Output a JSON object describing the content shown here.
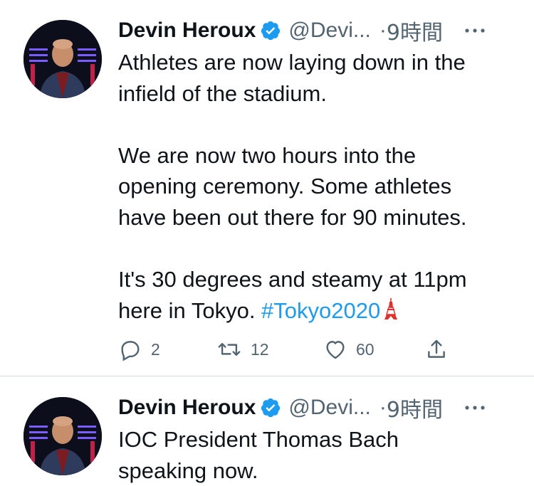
{
  "tweets": [
    {
      "author": {
        "name": "Devin Heroux",
        "handle": "@Devi...",
        "time": "9時間"
      },
      "lines": [
        "Athletes are now laying down in the",
        "infield of the stadium.",
        "",
        "We are now two hours into the",
        "opening ceremony. Some athletes",
        "have been out there for 90 minutes.",
        "",
        "It's 30 degrees and steamy at 11pm"
      ],
      "last_line_text": "here in Tokyo. ",
      "hashtag": "#Tokyo2020",
      "emoji_icon": "tokyo-tower-icon",
      "actions": {
        "replies": "2",
        "retweets": "12",
        "likes": "60"
      }
    },
    {
      "author": {
        "name": "Devin Heroux",
        "handle": "@Devi...",
        "time": "9時間"
      },
      "lines": [
        "IOC President Thomas Bach",
        "speaking now."
      ]
    }
  ],
  "colors": {
    "hashtag": "#1d9bf0",
    "verified": "#1d9bf0",
    "secondary_text": "#536471"
  },
  "icons": [
    "verified-badge-icon",
    "more-icon",
    "reply-icon",
    "retweet-icon",
    "like-icon",
    "share-icon"
  ]
}
